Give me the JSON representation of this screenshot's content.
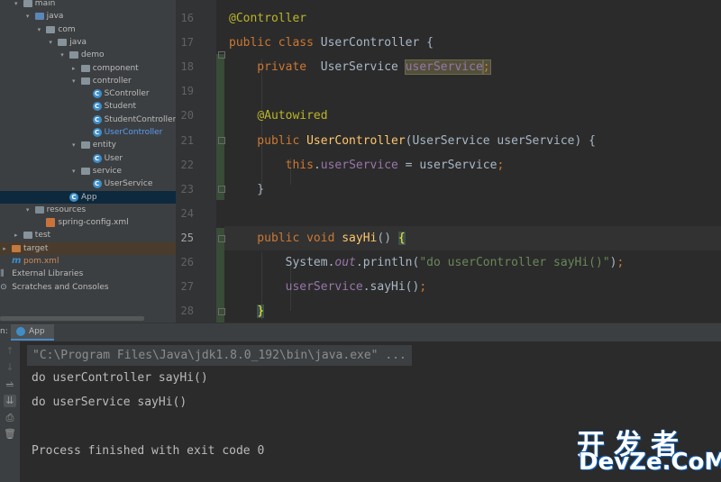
{
  "project_tree": {
    "items": [
      {
        "label": "main",
        "depth": 1,
        "icon": "folder-icon",
        "expanded": true
      },
      {
        "label": "java",
        "depth": 2,
        "icon": "source-folder-icon",
        "expanded": true
      },
      {
        "label": "com",
        "depth": 3,
        "icon": "package-icon",
        "expanded": true
      },
      {
        "label": "java",
        "depth": 4,
        "icon": "package-icon",
        "expanded": true
      },
      {
        "label": "demo",
        "depth": 5,
        "icon": "package-icon",
        "expanded": true
      },
      {
        "label": "component",
        "depth": 6,
        "icon": "package-icon",
        "expanded": false
      },
      {
        "label": "controller",
        "depth": 6,
        "icon": "package-icon",
        "expanded": true
      },
      {
        "label": "SController",
        "depth": 7,
        "icon": "class-icon"
      },
      {
        "label": "Student",
        "depth": 7,
        "icon": "class-icon"
      },
      {
        "label": "StudentController",
        "depth": 7,
        "icon": "class-icon"
      },
      {
        "label": "UserController",
        "depth": 7,
        "icon": "class-icon",
        "active": true
      },
      {
        "label": "entity",
        "depth": 6,
        "icon": "package-icon",
        "expanded": true
      },
      {
        "label": "User",
        "depth": 7,
        "icon": "class-icon"
      },
      {
        "label": "service",
        "depth": 6,
        "icon": "package-icon",
        "expanded": true
      },
      {
        "label": "UserService",
        "depth": 7,
        "icon": "class-icon"
      },
      {
        "label": "App",
        "depth": 5,
        "icon": "class-icon",
        "selected": true
      },
      {
        "label": "resources",
        "depth": 2,
        "icon": "resources-folder-icon",
        "expanded": true
      },
      {
        "label": "spring-config.xml",
        "depth": 3,
        "icon": "xml-file-icon"
      },
      {
        "label": "test",
        "depth": 1,
        "icon": "folder-icon",
        "expanded": false
      },
      {
        "label": "target",
        "depth": 0,
        "icon": "excluded-folder-icon",
        "expanded": false,
        "highlight": true
      },
      {
        "label": "pom.xml",
        "depth": 0,
        "icon": "maven-icon",
        "modified": true
      },
      {
        "label": "External Libraries",
        "depth": -1,
        "icon": "libraries-icon",
        "expanded": false
      },
      {
        "label": "Scratches and Consoles",
        "depth": -1,
        "icon": "scratches-icon",
        "expanded": false
      }
    ]
  },
  "editor": {
    "lines": [
      {
        "num": "16",
        "tokens": [
          {
            "t": "@Controller",
            "c": "ann"
          }
        ]
      },
      {
        "num": "17",
        "tokens": [
          {
            "t": "public class ",
            "c": "kw"
          },
          {
            "t": "UserController {",
            "c": ""
          }
        ]
      },
      {
        "num": "18",
        "tokens": [
          {
            "t": "    private  ",
            "c": "kw"
          },
          {
            "t": "UserService ",
            "c": ""
          },
          {
            "t": "userService",
            "c": "fld boxhl"
          },
          {
            "t": ";",
            "c": "kw boxhl"
          }
        ]
      },
      {
        "num": "19",
        "tokens": []
      },
      {
        "num": "20",
        "tokens": [
          {
            "t": "    ",
            "c": ""
          },
          {
            "t": "@Autowired",
            "c": "ann"
          }
        ]
      },
      {
        "num": "21",
        "tokens": [
          {
            "t": "    public ",
            "c": "kw"
          },
          {
            "t": "UserController",
            "c": "fn"
          },
          {
            "t": "(UserService userService) {",
            "c": ""
          }
        ]
      },
      {
        "num": "22",
        "tokens": [
          {
            "t": "        ",
            "c": ""
          },
          {
            "t": "this",
            "c": "kw"
          },
          {
            "t": ".",
            "c": ""
          },
          {
            "t": "userService",
            "c": "fld"
          },
          {
            "t": " = userService",
            "c": ""
          },
          {
            "t": ";",
            "c": "kw"
          }
        ]
      },
      {
        "num": "23",
        "tokens": [
          {
            "t": "    }",
            "c": ""
          }
        ]
      },
      {
        "num": "24",
        "tokens": []
      },
      {
        "num": "25",
        "tokens": [
          {
            "t": "    public void ",
            "c": "kw"
          },
          {
            "t": "sayHi",
            "c": "fn"
          },
          {
            "t": "() ",
            "c": ""
          },
          {
            "t": "{",
            "c": "brace"
          }
        ],
        "current": true
      },
      {
        "num": "26",
        "tokens": [
          {
            "t": "        System.",
            "c": ""
          },
          {
            "t": "out",
            "c": "it"
          },
          {
            "t": ".println(",
            "c": ""
          },
          {
            "t": "\"do userController sayHi()\"",
            "c": "str"
          },
          {
            "t": ")",
            "c": ""
          },
          {
            "t": ";",
            "c": "kw"
          }
        ]
      },
      {
        "num": "27",
        "tokens": [
          {
            "t": "        ",
            "c": ""
          },
          {
            "t": "userService",
            "c": "fld"
          },
          {
            "t": ".sayHi()",
            "c": ""
          },
          {
            "t": ";",
            "c": "kw"
          }
        ]
      },
      {
        "num": "28",
        "tokens": [
          {
            "t": "    ",
            "c": ""
          },
          {
            "t": "}",
            "c": "brace"
          }
        ]
      }
    ]
  },
  "run_panel": {
    "label": "n:",
    "tab": "App",
    "command": "\"C:\\Program Files\\Java\\jdk1.8.0_192\\bin\\java.exe\" ...",
    "output": [
      "do userController sayHi()",
      "do userService sayHi()",
      "",
      "Process finished with exit code 0"
    ]
  },
  "watermark": {
    "top": "开发者",
    "bottom": "DevZe.CoM"
  },
  "colors": {
    "keyword": "#cc7832",
    "annotation": "#bbb529",
    "method": "#ffc66d",
    "field": "#9876aa",
    "string": "#6a8759",
    "selection": "#0d293e"
  }
}
